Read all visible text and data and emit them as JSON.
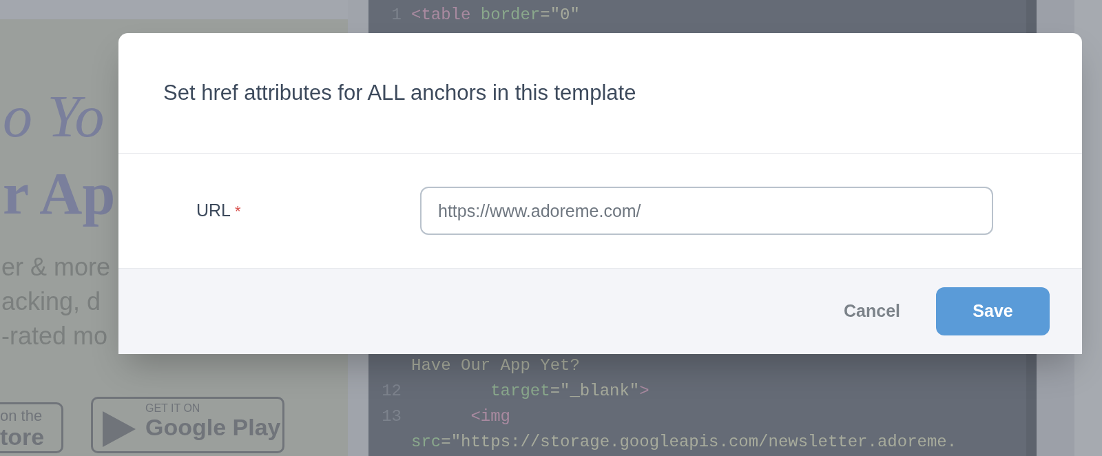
{
  "preview": {
    "heading_lines": [
      {
        "kind": "italic",
        "text": "o Yo"
      },
      {
        "kind": "bold",
        "text": "r Ap"
      }
    ],
    "body_lines": [
      "er & more",
      "acking, d",
      "-rated mo"
    ],
    "badges": [
      {
        "kind": "apple",
        "small": "on the",
        "large": "tore"
      },
      {
        "kind": "google",
        "small": "GET IT ON",
        "large": "Google Play"
      }
    ]
  },
  "code": {
    "top_lines": [
      {
        "number": "1",
        "tokens": [
          {
            "kind": "tag",
            "text": "<table"
          },
          {
            "kind": "attr",
            "text": " border"
          },
          {
            "kind": "punct",
            "text": "="
          },
          {
            "kind": "string",
            "text": "\"0\""
          }
        ]
      }
    ],
    "bottom_lines": [
      {
        "tokens": [
          {
            "kind": "string",
            "text": "Have Our App Yet?"
          }
        ]
      },
      {
        "number": "12",
        "tokens": [
          {
            "kind": "attr",
            "text": "        target"
          },
          {
            "kind": "punct",
            "text": "="
          },
          {
            "kind": "string",
            "text": "\"_blank\""
          },
          {
            "kind": "tag",
            "text": ">"
          }
        ]
      },
      {
        "number": "13",
        "tokens": [
          {
            "kind": "tag",
            "text": "      <img"
          }
        ]
      },
      {
        "tokens": [
          {
            "kind": "attr",
            "text": "src"
          },
          {
            "kind": "punct",
            "text": "="
          },
          {
            "kind": "string",
            "text": "\"https://storage.googleapis.com/newsletter.adoreme."
          }
        ]
      }
    ]
  },
  "dialog": {
    "title": "Set href attributes for ALL anchors in this template",
    "fields": [
      {
        "label": "URL",
        "required": true,
        "required_mark": "*",
        "value": "https://www.adoreme.com/"
      }
    ],
    "buttons": [
      {
        "label": "Cancel",
        "kind": "secondary"
      },
      {
        "label": "Save",
        "kind": "primary"
      }
    ]
  }
}
